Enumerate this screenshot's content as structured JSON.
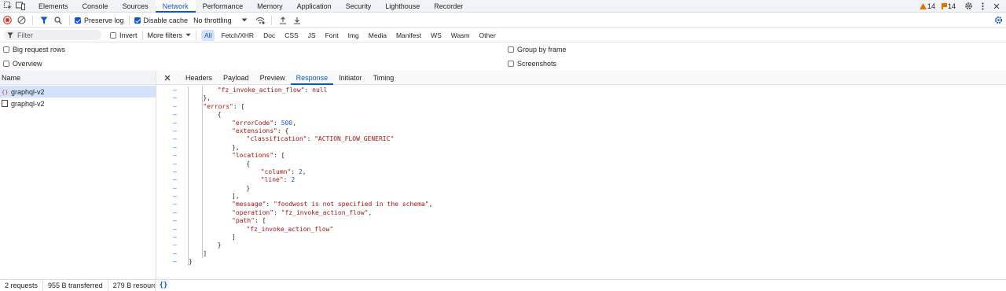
{
  "tabs": [
    "Elements",
    "Console",
    "Sources",
    "Network",
    "Performance",
    "Memory",
    "Application",
    "Security",
    "Lighthouse",
    "Recorder"
  ],
  "active_tab": "Network",
  "warnings_count": "14",
  "issues_count": "14",
  "toolbar": {
    "preserve_log": "Preserve log",
    "disable_cache": "Disable cache",
    "throttling": "No throttling"
  },
  "filter": {
    "placeholder": "Filter",
    "invert": "Invert",
    "more_filters": "More filters",
    "chips": [
      "All",
      "Fetch/XHR",
      "Doc",
      "CSS",
      "JS",
      "Font",
      "Img",
      "Media",
      "Manifest",
      "WS",
      "Wasm",
      "Other"
    ]
  },
  "options": {
    "big_request_rows": "Big request rows",
    "group_by_frame": "Group by frame",
    "overview": "Overview",
    "screenshots": "Screenshots"
  },
  "requests": {
    "header": "Name",
    "items": [
      "graphql-v2",
      "graphql-v2"
    ]
  },
  "detail_tabs": [
    "Headers",
    "Payload",
    "Preview",
    "Response",
    "Initiator",
    "Timing"
  ],
  "active_detail_tab": "Response",
  "response_lines": [
    {
      "indent": 4,
      "parts": [
        [
          "k",
          "\"fz_invoke_action_flow\""
        ],
        [
          "p",
          ": "
        ],
        [
          "kw",
          "null"
        ]
      ]
    },
    {
      "indent": 2,
      "parts": [
        [
          "p",
          "},"
        ]
      ]
    },
    {
      "indent": 2,
      "parts": [
        [
          "k",
          "\"errors\""
        ],
        [
          "p",
          ": ["
        ]
      ]
    },
    {
      "indent": 4,
      "parts": [
        [
          "p",
          "{"
        ]
      ]
    },
    {
      "indent": 6,
      "parts": [
        [
          "k",
          "\"errorCode\""
        ],
        [
          "p",
          ": "
        ],
        [
          "n",
          "500"
        ],
        [
          "p",
          ","
        ]
      ]
    },
    {
      "indent": 6,
      "parts": [
        [
          "k",
          "\"extensions\""
        ],
        [
          "p",
          ": {"
        ]
      ]
    },
    {
      "indent": 8,
      "parts": [
        [
          "k",
          "\"classification\""
        ],
        [
          "p",
          ": "
        ],
        [
          "s",
          "\"ACTION_FLOW_GENERIC\""
        ]
      ]
    },
    {
      "indent": 6,
      "parts": [
        [
          "p",
          "},"
        ]
      ]
    },
    {
      "indent": 6,
      "parts": [
        [
          "k",
          "\"locations\""
        ],
        [
          "p",
          ": ["
        ]
      ]
    },
    {
      "indent": 8,
      "parts": [
        [
          "p",
          "{"
        ]
      ]
    },
    {
      "indent": 10,
      "parts": [
        [
          "k",
          "\"column\""
        ],
        [
          "p",
          ": "
        ],
        [
          "n",
          "2"
        ],
        [
          "p",
          ","
        ]
      ]
    },
    {
      "indent": 10,
      "parts": [
        [
          "k",
          "\"line\""
        ],
        [
          "p",
          ": "
        ],
        [
          "n",
          "2"
        ]
      ]
    },
    {
      "indent": 8,
      "parts": [
        [
          "p",
          "}"
        ]
      ]
    },
    {
      "indent": 6,
      "parts": [
        [
          "p",
          "],"
        ]
      ]
    },
    {
      "indent": 6,
      "parts": [
        [
          "k",
          "\"message\""
        ],
        [
          "p",
          ": "
        ],
        [
          "s",
          "\"foodwost is not specified in the schema\""
        ],
        [
          "p",
          ","
        ]
      ]
    },
    {
      "indent": 6,
      "parts": [
        [
          "k",
          "\"operation\""
        ],
        [
          "p",
          ": "
        ],
        [
          "s",
          "\"fz_invoke_action_flow\""
        ],
        [
          "p",
          ","
        ]
      ]
    },
    {
      "indent": 6,
      "parts": [
        [
          "k",
          "\"path\""
        ],
        [
          "p",
          ": ["
        ]
      ]
    },
    {
      "indent": 8,
      "parts": [
        [
          "s",
          "\"fz_invoke_action_flow\""
        ]
      ]
    },
    {
      "indent": 6,
      "parts": [
        [
          "p",
          "]"
        ]
      ]
    },
    {
      "indent": 4,
      "parts": [
        [
          "p",
          "}"
        ]
      ]
    },
    {
      "indent": 2,
      "parts": [
        [
          "p",
          "]"
        ]
      ]
    },
    {
      "indent": 0,
      "parts": [
        [
          "p",
          "}"
        ]
      ]
    }
  ],
  "gutter_mark": "–",
  "status": {
    "requests": "2 requests",
    "transferred": "955 B transferred",
    "resources": "279 B resourc",
    "pretty_print": "{}"
  },
  "colors": {
    "accent": "#0b57d0",
    "warning": "#e37400",
    "issue": "#e37400",
    "record": "#d93025"
  }
}
